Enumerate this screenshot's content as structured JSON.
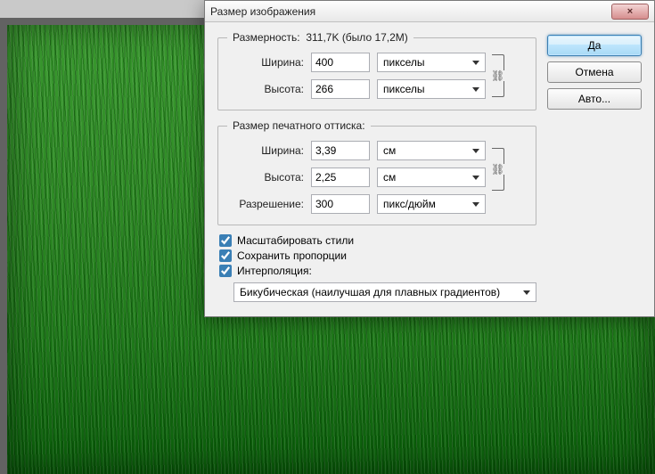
{
  "titlebar": {
    "title": "Размер изображения",
    "close": "×"
  },
  "buttons": {
    "ok": "Да",
    "cancel": "Отмена",
    "auto": "Авто..."
  },
  "pixel_group": {
    "legend_prefix": "Размерность:",
    "size": "311,7K",
    "was": "(было 17,2M)",
    "width_label": "Ширина:",
    "width_value": "400",
    "width_unit": "пикселы",
    "height_label": "Высота:",
    "height_value": "266",
    "height_unit": "пикселы"
  },
  "print_group": {
    "legend": "Размер печатного оттиска:",
    "width_label": "Ширина:",
    "width_value": "3,39",
    "width_unit": "см",
    "height_label": "Высота:",
    "height_value": "2,25",
    "height_unit": "см",
    "res_label": "Разрешение:",
    "res_value": "300",
    "res_unit": "пикс/дюйм"
  },
  "checks": {
    "scale_styles": "Масштабировать стили",
    "constrain": "Сохранить пропорции",
    "resample": "Интерполяция:"
  },
  "interp": {
    "selected": "Бикубическая (наилучшая для плавных градиентов)"
  },
  "chain": "⛓"
}
